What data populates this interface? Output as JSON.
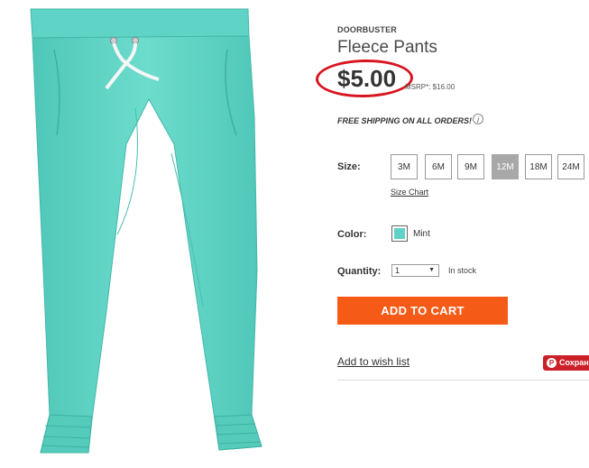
{
  "product": {
    "badge": "DOORBUSTER",
    "title": "Fleece Pants",
    "price": "$5.00",
    "msrp": "MSRP*: $16.00",
    "shipping": "FREE SHIPPING ON ALL ORDERS!",
    "info_glyph": "i"
  },
  "size": {
    "label": "Size:",
    "options": [
      "3M",
      "6M",
      "9M",
      "12M",
      "18M",
      "24M"
    ],
    "selected": "12M",
    "chart_link": "Size Chart"
  },
  "color": {
    "label": "Color:",
    "name": "Mint",
    "swatch_hex": "#5fd3c6"
  },
  "quantity": {
    "label": "Quantity:",
    "value": "1",
    "stock": "In stock"
  },
  "actions": {
    "add_to_cart": "ADD TO CART",
    "wishlist": "Add to wish list",
    "pin_label": "Сохран",
    "pin_glyph": "P"
  },
  "colors": {
    "accent": "#f55a16",
    "highlight_circle": "#d8141e",
    "pinterest": "#cb2027",
    "product": "#5fd3c6"
  }
}
